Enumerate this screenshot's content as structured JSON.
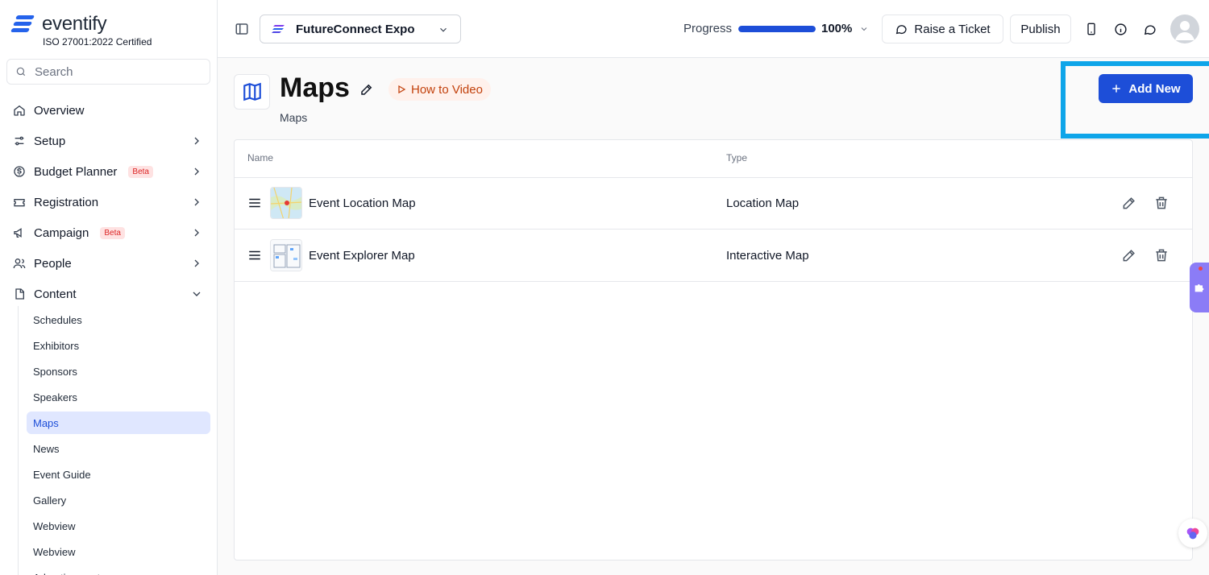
{
  "brand": {
    "name": "eventify",
    "certification": "ISO 27001:2022 Certified",
    "accent": "#2563eb"
  },
  "sidebar": {
    "search_placeholder": "Search",
    "items": [
      {
        "label": "Overview",
        "icon": "home-icon"
      },
      {
        "label": "Setup",
        "icon": "sliders-icon"
      },
      {
        "label": "Budget Planner",
        "badge": "Beta",
        "icon": "dollar-icon"
      },
      {
        "label": "Registration",
        "icon": "ticket-icon"
      },
      {
        "label": "Campaign",
        "badge": "Beta",
        "icon": "megaphone-icon"
      },
      {
        "label": "People",
        "icon": "users-icon"
      },
      {
        "label": "Content",
        "icon": "document-icon"
      }
    ],
    "content_items": [
      "Schedules",
      "Exhibitors",
      "Sponsors",
      "Speakers",
      "Maps",
      "News",
      "Event Guide",
      "Gallery",
      "Webview",
      "Webview",
      "Advertisement"
    ],
    "active_item": "Maps"
  },
  "header": {
    "event_name": "FutureConnect Expo",
    "progress_label": "Progress",
    "progress_value": "100%",
    "progress_fraction": 1.0,
    "raise_ticket": "Raise a Ticket",
    "publish": "Publish"
  },
  "page": {
    "title": "Maps",
    "subtitle": "Maps",
    "how_to": "How to Video",
    "add_new": "Add New"
  },
  "table": {
    "columns": [
      "Name",
      "Type"
    ],
    "rows": [
      {
        "name": "Event Location Map",
        "type": "Location Map"
      },
      {
        "name": "Event Explorer Map",
        "type": "Interactive Map"
      }
    ]
  }
}
